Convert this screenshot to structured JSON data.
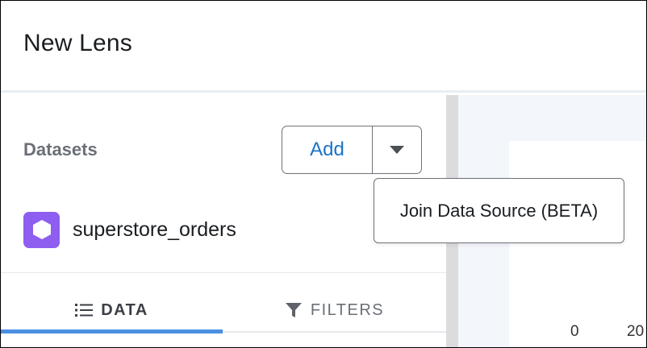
{
  "header": {
    "title": "New Lens"
  },
  "datasets": {
    "label": "Datasets",
    "add_button": {
      "label": "Add",
      "dropdown_icon": "caret-down-icon"
    },
    "items": [
      {
        "name": "superstore_orders",
        "icon": "hexagon-icon",
        "icon_color": "#8e5ef0"
      }
    ]
  },
  "dropdown_menu": {
    "items": [
      {
        "label": "Join Data Source (BETA)"
      }
    ]
  },
  "tabs": [
    {
      "label": "DATA",
      "icon": "list-icon",
      "active": true
    },
    {
      "label": "FILTERS",
      "icon": "filter-icon",
      "active": false
    }
  ],
  "canvas": {
    "axis_ticks": [
      "0",
      "20"
    ]
  },
  "colors": {
    "accent": "#1a73c8",
    "tab_active_underline": "#4a90e2",
    "dataset_icon": "#8e5ef0",
    "canvas_background": "#f3f6fa"
  }
}
